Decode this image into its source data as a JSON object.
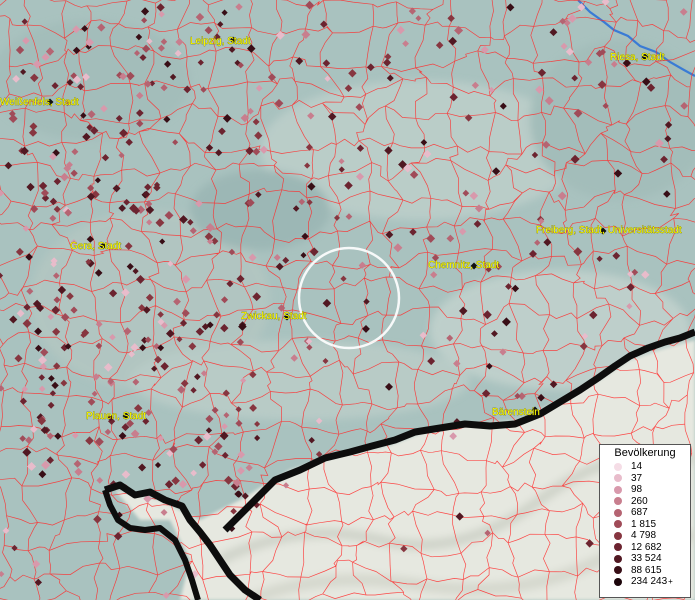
{
  "map": {
    "colors": {
      "terrain_base": "#a9c2bf",
      "terrain_light": "#d6dfd9",
      "snow": "#e9ebe4",
      "boundary": "#ff2a2a",
      "river": "#3a7bd5",
      "ridge": "#0d0d0d",
      "label_text": "#ffff00"
    },
    "cities": [
      {
        "name": "Leipzig, Stadt"
      },
      {
        "name": "Riesa, Stadt"
      },
      {
        "name": "Weißenfels, Stadt"
      },
      {
        "name": "Gera, Stadt"
      },
      {
        "name": "Freiberg, Stadt, Universitätsstadt"
      },
      {
        "name": "Chemnitz, Stadt"
      },
      {
        "name": "Zwickau, Stadt"
      },
      {
        "name": "Plauen, Stadt"
      },
      {
        "name": "Bärenstein"
      }
    ],
    "highlight": {
      "kind": "circle",
      "color": "#ffffff"
    }
  },
  "legend": {
    "title": "Bevölkerung",
    "items": [
      {
        "value": "14",
        "color": "#f5dde6"
      },
      {
        "value": "37",
        "color": "#e8bccb"
      },
      {
        "value": "98",
        "color": "#d899ac"
      },
      {
        "value": "260",
        "color": "#c87e8e"
      },
      {
        "value": "687",
        "color": "#b56472"
      },
      {
        "value": "1 815",
        "color": "#a04b58"
      },
      {
        "value": "4 798",
        "color": "#873640"
      },
      {
        "value": "12 682",
        "color": "#6c2430"
      },
      {
        "value": "33 524",
        "color": "#511822"
      },
      {
        "value": "88 615",
        "color": "#380e16"
      },
      {
        "value": "234 243",
        "color": "#1c050a",
        "plus": "+"
      }
    ]
  }
}
